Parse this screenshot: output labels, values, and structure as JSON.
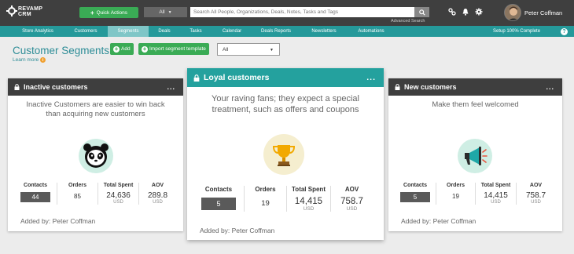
{
  "app": {
    "logo_line1": "REVAMP",
    "logo_line2": "CRM"
  },
  "topbar": {
    "quick_actions_label": "Quick Actions",
    "search_scope": "All",
    "search_placeholder": "Search All People, Organizations, Deals, Notes, Tasks and Tags",
    "advanced_search": "Advanced Search",
    "username": "Peter Coffman"
  },
  "nav": {
    "items": [
      "Store Analytics",
      "Customers",
      "Segments",
      "Deals",
      "Tasks",
      "Calendar",
      "Deals Reports",
      "Newsletters",
      "Automations"
    ],
    "active": "Segments",
    "setup": "Setup 100% Complete",
    "help": "?"
  },
  "page": {
    "title": "Customer Segments:",
    "add_label": "Add",
    "import_label": "Import segment template",
    "filter_value": "All",
    "learn_more": "Learn more"
  },
  "cards": [
    {
      "title": "Inactive customers",
      "menu": "...",
      "description": "Inactive Customers are easier to win back than acquiring new customers",
      "icon": "panda-icon",
      "stats": {
        "contacts_label": "Contacts",
        "contacts": "44",
        "orders_label": "Orders",
        "orders": "85",
        "spent_label": "Total Spent",
        "spent": "24,636",
        "spent_unit": "USD",
        "aov_label": "AOV",
        "aov": "289.8",
        "aov_unit": "USD"
      },
      "added_by": "Added by: Peter Coffman"
    },
    {
      "title": "Loyal customers",
      "menu": "...",
      "description": "Your raving fans; they expect a special treatment, such as offers and coupons",
      "icon": "trophy-icon",
      "stats": {
        "contacts_label": "Contacts",
        "contacts": "5",
        "orders_label": "Orders",
        "orders": "19",
        "spent_label": "Total Spent",
        "spent": "14,415",
        "spent_unit": "USD",
        "aov_label": "AOV",
        "aov": "758.7",
        "aov_unit": "USD"
      },
      "added_by": "Added by: Peter Coffman"
    },
    {
      "title": "New customers",
      "menu": "...",
      "description": "Make them feel welcomed",
      "icon": "megaphone-icon",
      "stats": {
        "contacts_label": "Contacts",
        "contacts": "5",
        "orders_label": "Orders",
        "orders": "19",
        "spent_label": "Total Spent",
        "spent": "14,415",
        "spent_unit": "USD",
        "aov_label": "AOV",
        "aov": "758.7",
        "aov_unit": "USD"
      },
      "added_by": "Added by: Peter Coffman"
    }
  ],
  "colors": {
    "topbar": "#3f3f3f",
    "nav": "#25999a",
    "nav_active": "#7fc6c7",
    "green": "#3aab55",
    "card_header_dark": "#3e3e3e",
    "card_header_teal": "#24a19e"
  }
}
